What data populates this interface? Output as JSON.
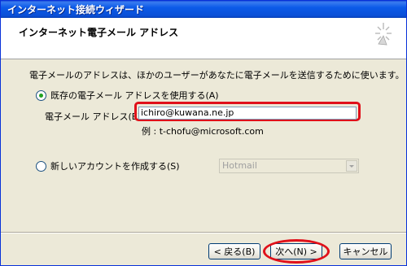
{
  "window": {
    "title": "インターネット接続ウィザード"
  },
  "header": {
    "title": "インターネット電子メール アドレス"
  },
  "content": {
    "description": "電子メールのアドレスは、ほかのユーザーがあなたに電子メールを送信するために使います。",
    "use_existing_label": "既存の電子メール アドレスを使用する(A)",
    "email_field_label": "電子メール アドレス(E):",
    "email_value": "ichiro@kuwana.ne.jp",
    "example_text": "例 : t-chofu@microsoft.com",
    "create_new_label": "新しいアカウントを作成する(S)",
    "provider_selected": "Hotmail"
  },
  "buttons": {
    "back": "< 戻る(B)",
    "next": "次へ(N) >",
    "cancel": "キャンセル"
  },
  "colors": {
    "highlight": "#e0101a",
    "title_bar": "#0b5ae8"
  }
}
